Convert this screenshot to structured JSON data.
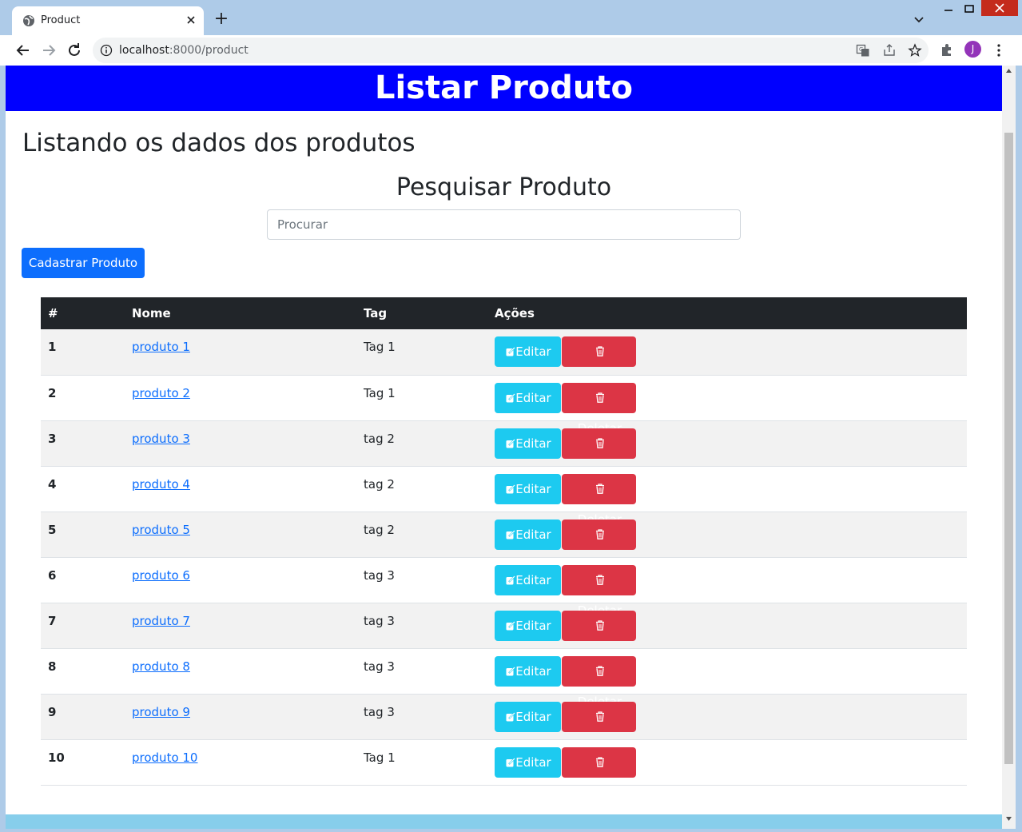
{
  "browser": {
    "tab_title": "Product",
    "new_tab_symbol": "+",
    "url_host": "localhost",
    "url_rest": ":8000/product",
    "profile_initial": "J"
  },
  "header": {
    "title": "Listar Produto",
    "color": "#0000ff"
  },
  "page": {
    "title": "Listando os dados dos produtos",
    "search_title": "Pesquisar Produto",
    "search_placeholder": "Procurar",
    "add_button": "Cadastrar Produto"
  },
  "table": {
    "headers": {
      "id": "#",
      "name": "Nome",
      "tag": "Tag",
      "actions": "Ações"
    },
    "edit_label": "Editar",
    "delete_label": "Deletar",
    "rows": [
      {
        "id": "1",
        "name": "produto 1",
        "tag": "Tag 1"
      },
      {
        "id": "2",
        "name": "produto 2",
        "tag": "Tag 1"
      },
      {
        "id": "3",
        "name": "produto 3",
        "tag": "tag 2"
      },
      {
        "id": "4",
        "name": "produto 4",
        "tag": "tag 2"
      },
      {
        "id": "5",
        "name": "produto 5",
        "tag": "tag 2"
      },
      {
        "id": "6",
        "name": "produto 6",
        "tag": "tag 3"
      },
      {
        "id": "7",
        "name": "produto 7",
        "tag": "tag 3"
      },
      {
        "id": "8",
        "name": "produto 8",
        "tag": "tag 3"
      },
      {
        "id": "9",
        "name": "produto 9",
        "tag": "tag 3"
      },
      {
        "id": "10",
        "name": "produto 10",
        "tag": "Tag 1"
      }
    ]
  },
  "colors": {
    "primary": "#0d6efd",
    "info": "#1dcaf0",
    "danger": "#dc3545",
    "table_dark": "#212529",
    "footer": "#87ceeb"
  }
}
